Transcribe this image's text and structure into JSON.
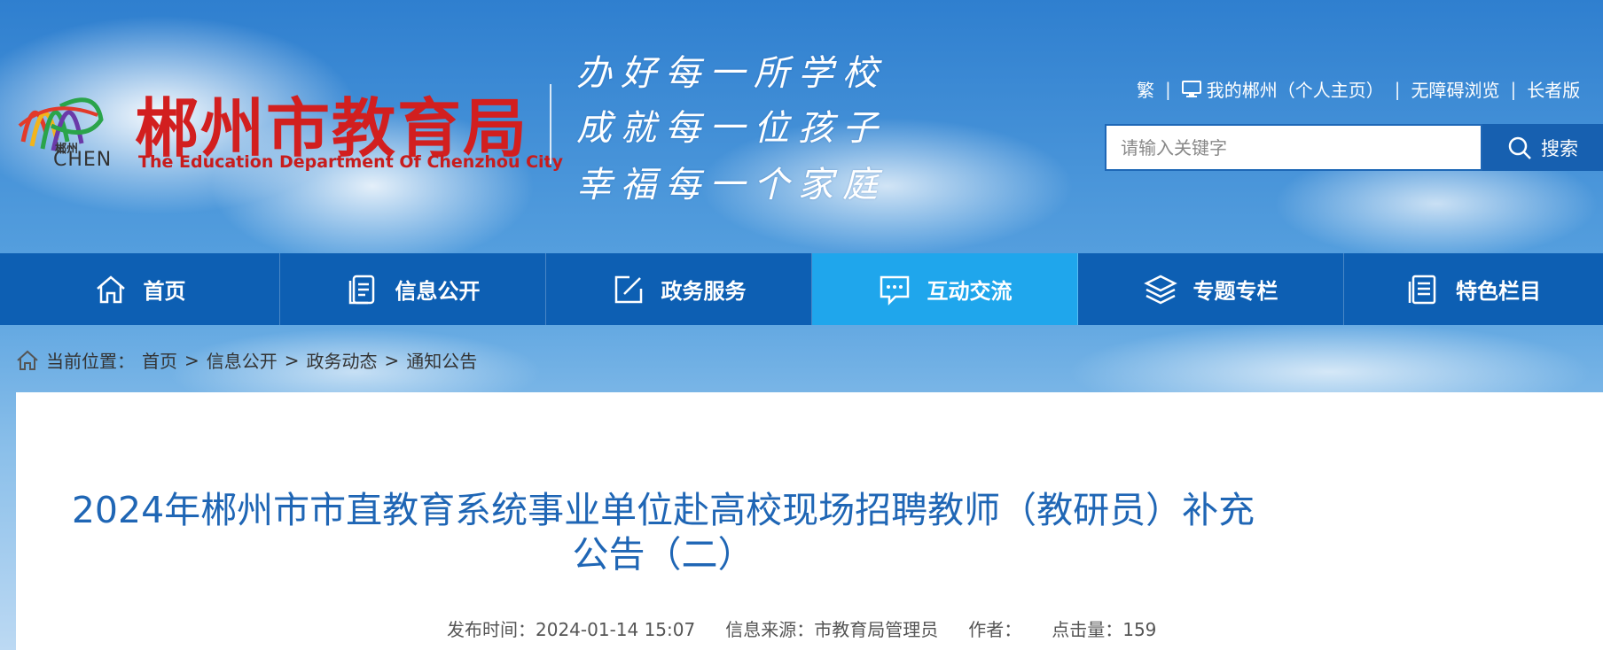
{
  "header": {
    "site_title_cn": "郴州市教育局",
    "site_title_en": "The Education Department Of Chenzhou City",
    "logo_sub": "郴州",
    "logo_text": "CHEN",
    "slogan": [
      "办好每一所学校",
      "成就每一位孩子",
      "幸福每一个家庭"
    ],
    "top_links": {
      "traditional": "繁",
      "my_chenzhou": "我的郴州（个人主页）",
      "accessibility": "无障碍浏览",
      "elder": "长者版"
    },
    "search": {
      "placeholder": "请输入关键字",
      "button_label": "搜索"
    }
  },
  "nav": {
    "items": [
      {
        "label": "首页",
        "icon": "home-icon"
      },
      {
        "label": "信息公开",
        "icon": "document-icon"
      },
      {
        "label": "政务服务",
        "icon": "edit-icon"
      },
      {
        "label": "互动交流",
        "icon": "chat-icon"
      },
      {
        "label": "专题专栏",
        "icon": "layers-icon"
      },
      {
        "label": "特色栏目",
        "icon": "list-icon"
      }
    ],
    "active_index": 3
  },
  "breadcrumb": {
    "prefix": "当前位置：",
    "items": [
      "首页",
      "信息公开",
      "政务动态",
      "通知公告"
    ],
    "separator": ">"
  },
  "article": {
    "title_line1": "2024年郴州市市直教育系统事业单位赴高校现场招聘教师（教研员）补充",
    "title_line2": "公告（二）",
    "publish_time": "发布时间：2024-01-14 15:07",
    "source": "信息来源：市教育局管理员",
    "author": "作者：",
    "views": "点击量：159"
  },
  "colors": {
    "nav_bg": "#0d5fb3",
    "nav_active": "#1fa6ec",
    "title_blue": "#1f66b5",
    "brand_red": "#d21f1f"
  }
}
